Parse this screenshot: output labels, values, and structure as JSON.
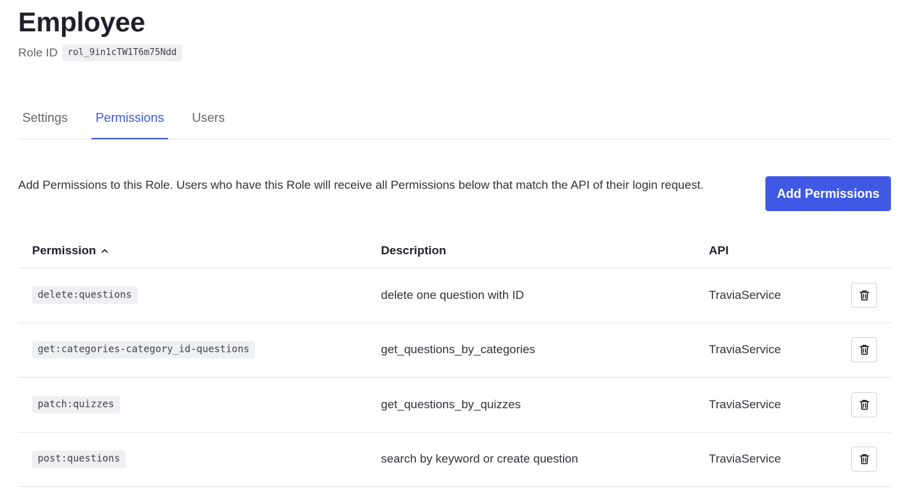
{
  "role": {
    "title": "Employee",
    "id_label": "Role ID",
    "id_value": "rol_9in1cTW1T6m75Ndd"
  },
  "tabs": [
    {
      "label": "Settings",
      "active": false
    },
    {
      "label": "Permissions",
      "active": true
    },
    {
      "label": "Users",
      "active": false
    }
  ],
  "permissions_panel": {
    "intro": "Add Permissions to this Role. Users who have this Role will receive all Permissions below that match the API of their login request.",
    "add_button_label": "Add Permissions"
  },
  "table": {
    "columns": {
      "permission": "Permission",
      "description": "Description",
      "api": "API"
    },
    "sort": {
      "column": "permission",
      "direction": "asc",
      "icon": "chevron-up-icon"
    },
    "rows": [
      {
        "permission": "delete:questions",
        "description": "delete one question with ID",
        "api": "TraviaService"
      },
      {
        "permission": "get:categories-category_id-questions",
        "description": "get_questions_by_categories",
        "api": "TraviaService"
      },
      {
        "permission": "patch:quizzes",
        "description": "get_questions_by_quizzes",
        "api": "TraviaService"
      },
      {
        "permission": "post:questions",
        "description": "search by keyword or create question",
        "api": "TraviaService"
      }
    ],
    "row_action_icon": "trash-icon"
  },
  "colors": {
    "accent": "#3f59e4",
    "text": "#1e212a",
    "muted": "#65676e",
    "border": "#e3e4e8",
    "code_bg": "#eff0f2"
  }
}
